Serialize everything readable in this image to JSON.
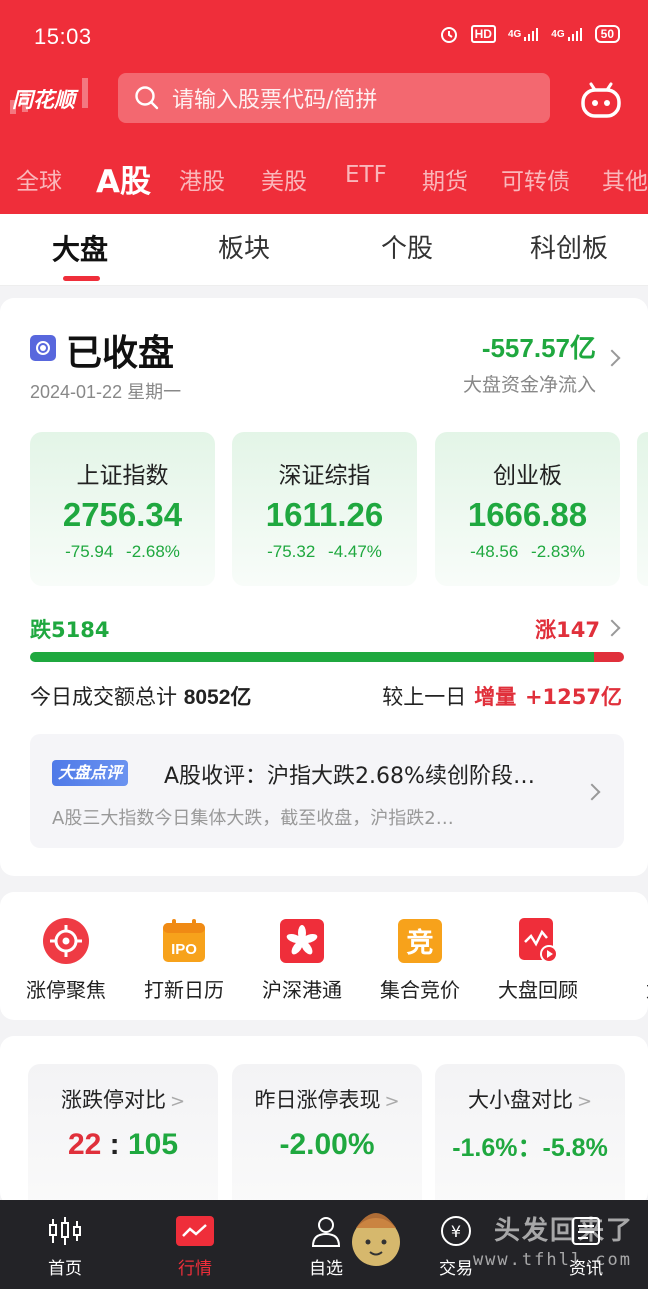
{
  "status_bar": {
    "time": "15:03",
    "hd": "HD",
    "net1": "4G",
    "net2": "4G",
    "battery": "50"
  },
  "header": {
    "logo": "同花顺",
    "search_placeholder": "请输入股票代码/简拼"
  },
  "market_tabs": [
    "全球",
    "A股",
    "港股",
    "美股",
    "ETF",
    "期货",
    "可转债",
    "其他"
  ],
  "sub_tabs": [
    "大盘",
    "板块",
    "个股",
    "科创板"
  ],
  "market": {
    "status": "已收盘",
    "date": "2024-01-22 星期一",
    "net_flow": "-557.57亿",
    "net_flow_label": "大盘资金净流入",
    "indices": [
      {
        "name": "上证指数",
        "value": "2756.34",
        "change": "-75.94",
        "pct": "-2.68%"
      },
      {
        "name": "深证综指",
        "value": "1611.26",
        "change": "-75.32",
        "pct": "-4.47%"
      },
      {
        "name": "创业板",
        "value": "1666.88",
        "change": "-48.56",
        "pct": "-2.83%"
      }
    ],
    "fall_label": "跌5184",
    "rise_label": "涨147",
    "fall_count": 5184,
    "rise_count": 147,
    "turnover_label": "今日成交额总计",
    "turnover_value": "8052亿",
    "compare_label": "较上一日",
    "compare_inc_label": "增量",
    "compare_inc_value": "+1257亿",
    "colors": {
      "up": "#e0303b",
      "down": "#1fa83f",
      "brand": "#ef2e3a"
    }
  },
  "commentary": {
    "badge": "大盘点评",
    "title": "A股收评：沪指大跌2.68%续创阶段…",
    "body": "A股三大指数今日集体大跌，截至收盘，沪指跌2…"
  },
  "shortcuts": [
    {
      "label": "涨停聚焦",
      "icon": "target-icon"
    },
    {
      "label": "打新日历",
      "icon": "ipo-calendar-icon",
      "icon_text": "IPO"
    },
    {
      "label": "沪深港通",
      "icon": "hk-flower-icon"
    },
    {
      "label": "集合竞价",
      "icon": "auction-icon",
      "icon_text": "竞"
    },
    {
      "label": "大盘回顾",
      "icon": "replay-icon"
    },
    {
      "label": "龙",
      "icon": "dragon-icon"
    }
  ],
  "stats": [
    {
      "title": "涨跌停对比",
      "value_left": "22",
      "sep": ":",
      "value_right": "105"
    },
    {
      "title": "昨日涨停表现",
      "value": "-2.00%"
    },
    {
      "title": "大小盘对比",
      "value": "-1.6%：-5.8%"
    }
  ],
  "bottom_nav": [
    {
      "label": "首页",
      "icon": "candlestick-icon"
    },
    {
      "label": "行情",
      "icon": "chart-trend-icon"
    },
    {
      "label": "自选",
      "icon": "user-icon"
    },
    {
      "label": "交易",
      "icon": "trade-icon"
    },
    {
      "label": "资讯",
      "icon": "news-icon"
    }
  ],
  "watermark": {
    "text": "头发回来了",
    "sub": "www.tfhll.com"
  }
}
